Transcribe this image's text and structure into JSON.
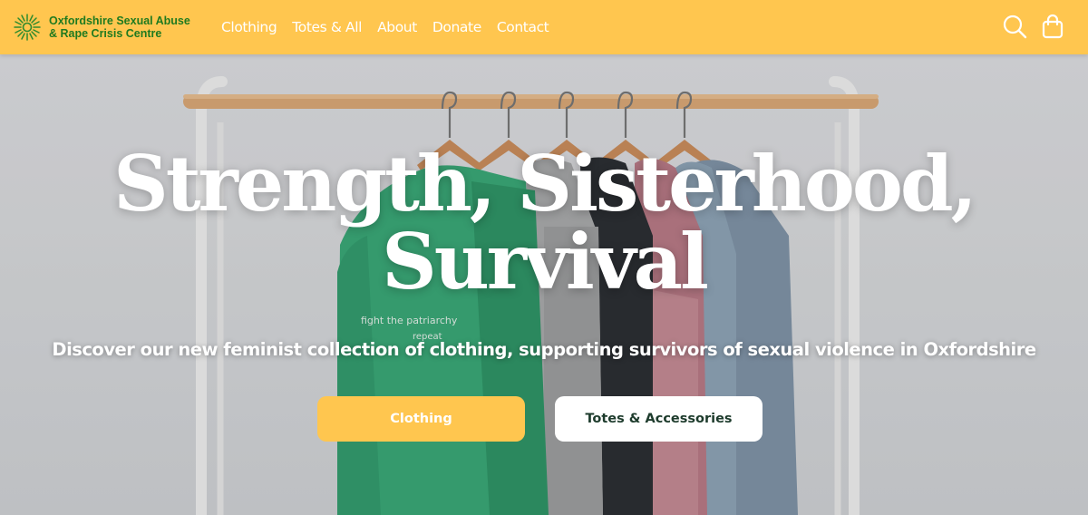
{
  "brand": {
    "line1": "Oxfordshire Sexual Abuse",
    "line2": "& Rape Crisis Centre",
    "logo_icon": "sunflower-logo-icon"
  },
  "nav": {
    "items": [
      {
        "label": "Clothing"
      },
      {
        "label": "Totes & All"
      },
      {
        "label": "About"
      },
      {
        "label": "Donate"
      },
      {
        "label": "Contact"
      }
    ]
  },
  "header_icons": [
    "search-icon",
    "shopping-bag-icon"
  ],
  "hero": {
    "title_line1": "Strength, Sisterhood,",
    "title_line2": "Survival",
    "subtitle": "Discover our new feminist collection of clothing, supporting survivors of sexual violence in Oxfordshire",
    "primary_button": "Clothing",
    "secondary_button": "Totes & Accessories",
    "hoodie_print": [
      "fight the patriarchy",
      "repeat"
    ]
  },
  "colors": {
    "header_bg": "#ffc64f",
    "brand_green": "#1f7a1f",
    "primary_button": "#ffc64f",
    "secondary_button": "#ffffff"
  }
}
